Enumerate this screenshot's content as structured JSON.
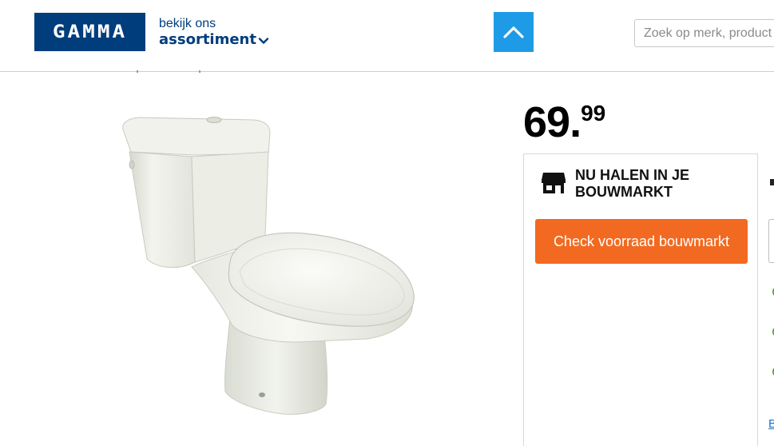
{
  "header": {
    "logo_text": "GAMMA",
    "assortment_small": "bekijk ons",
    "assortment_big": "assortiment",
    "search_placeholder": "Zoek op merk, product"
  },
  "product": {
    "image_alt": "Staand toilet wit",
    "price_main": "69.",
    "price_decimals": "99"
  },
  "store": {
    "title": "NU HALEN IN JE BOUWMARKT",
    "check_button": "Check voorraad bouwmarkt"
  },
  "edge": {
    "link_fragment": "B"
  },
  "colors": {
    "brand_blue": "#003d7c",
    "scroll_top_blue": "#1e9be6",
    "cta_orange": "#f26a21",
    "check_green": "#4ba82e"
  },
  "icons": {
    "scroll_up": "chevron-up-icon",
    "assortment_toggle": "chevron-down-icon",
    "store": "store-icon",
    "usp": "check-circle-icon"
  }
}
